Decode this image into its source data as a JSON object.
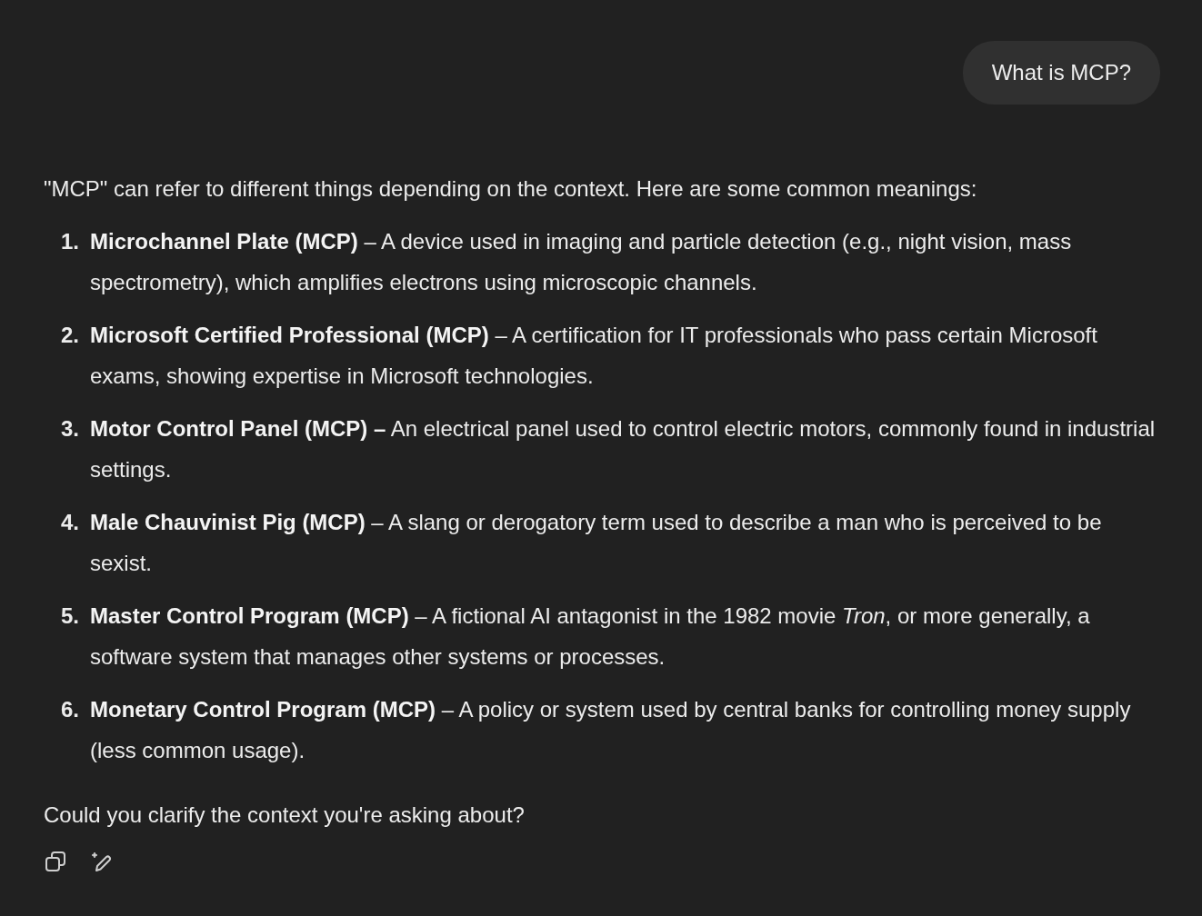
{
  "user_message": "What is MCP?",
  "response": {
    "intro": "\"MCP\" can refer to different things depending on the context. Here are some common meanings:",
    "items": [
      {
        "number": "1.",
        "text": "**Microchannel Plate (MCP)** – A device used in imaging and particle detection (e.g., night vision, mass spectrometry), which amplifies electrons using microscopic channels."
      },
      {
        "number": "2.",
        "text": "**Microsoft Certified Professional (MCP)** – A certification for IT professionals who pass certain Microsoft exams, showing expertise in Microsoft technologies."
      },
      {
        "number": "3.",
        "text": "**Motor Control Panel (MCP) –** An electrical panel used to control electric motors, commonly found in industrial settings."
      },
      {
        "number": "4.",
        "text": "**Male Chauvinist Pig (MCP)** – A slang or derogatory term used to describe a man who is perceived to be sexist."
      },
      {
        "number": "5.",
        "text": "**Master Control Program (MCP)** – A fictional AI antagonist in the 1982 movie *Tron*, or more generally, a software system that manages other systems or processes."
      },
      {
        "number": "6.",
        "text": "**Monetary Control Program (MCP)** – A policy or system used by central banks for controlling money supply (less common usage)."
      }
    ],
    "closing": "Could you clarify the context you're asking about?"
  }
}
